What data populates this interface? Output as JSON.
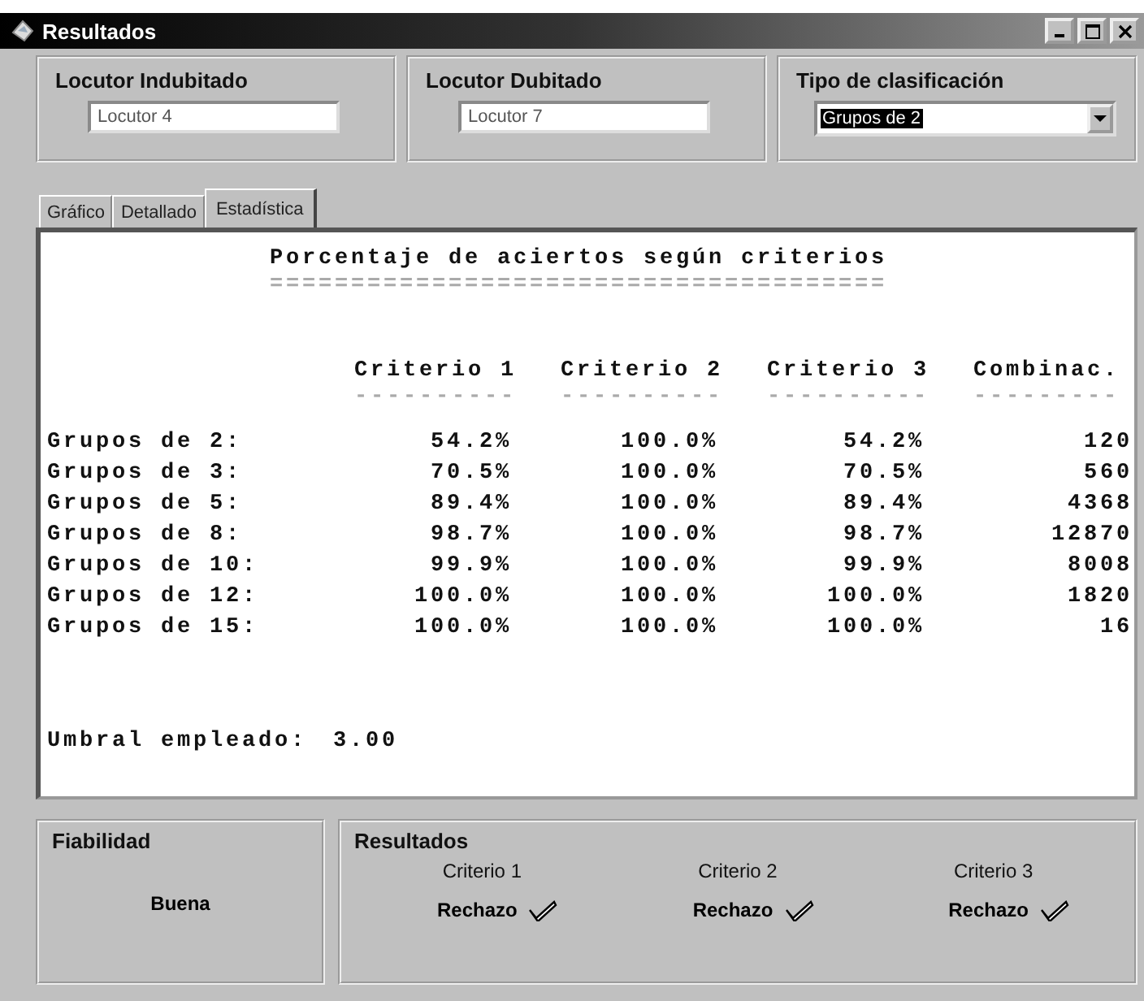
{
  "window": {
    "title": "Resultados"
  },
  "speaker_fields": [
    {
      "label": "Locutor Indubitado",
      "value": "Locutor 4"
    },
    {
      "label": "Locutor Dubitado",
      "value": "Locutor 7"
    }
  ],
  "classification": {
    "label": "Tipo de clasificación",
    "value": "Grupos de 2"
  },
  "tabs": [
    {
      "label": "Gráfico",
      "selected": false
    },
    {
      "label": "Detallado",
      "selected": false
    },
    {
      "label": "Estadística",
      "selected": true
    }
  ],
  "stats": {
    "title": "Porcentaje de aciertos según criterios",
    "title_rule": "======================================",
    "columns": [
      {
        "label": "Criterio 1",
        "rule": "----------"
      },
      {
        "label": "Criterio 2",
        "rule": "----------"
      },
      {
        "label": "Criterio 3",
        "rule": "----------"
      },
      {
        "label": "Combinac.",
        "rule": "---------"
      }
    ],
    "rows": [
      {
        "label": "Grupos de 2:",
        "values": [
          "54.2%",
          "100.0%",
          "54.2%",
          "120"
        ]
      },
      {
        "label": "Grupos de 3:",
        "values": [
          "70.5%",
          "100.0%",
          "70.5%",
          "560"
        ]
      },
      {
        "label": "Grupos de 5:",
        "values": [
          "89.4%",
          "100.0%",
          "89.4%",
          "4368"
        ]
      },
      {
        "label": "Grupos de 8:",
        "values": [
          "98.7%",
          "100.0%",
          "98.7%",
          "12870"
        ]
      },
      {
        "label": "Grupos de 10:",
        "values": [
          "99.9%",
          "100.0%",
          "99.9%",
          "8008"
        ]
      },
      {
        "label": "Grupos de 12:",
        "values": [
          "100.0%",
          "100.0%",
          "100.0%",
          "1820"
        ]
      },
      {
        "label": "Grupos de 15:",
        "values": [
          "100.0%",
          "100.0%",
          "100.0%",
          "16"
        ]
      }
    ],
    "threshold": {
      "label": "Umbral empleado:",
      "value": "3.00"
    }
  },
  "reliability": {
    "title": "Fiabilidad",
    "value": "Buena"
  },
  "results": {
    "title": "Resultados",
    "criteria": [
      {
        "label": "Criterio 1",
        "verdict": "Rechazo"
      },
      {
        "label": "Criterio 2",
        "verdict": "Rechazo"
      },
      {
        "label": "Criterio 3",
        "verdict": "Rechazo"
      }
    ]
  }
}
